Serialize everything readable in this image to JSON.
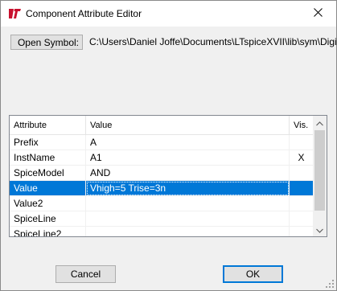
{
  "window": {
    "title": "Component Attribute Editor"
  },
  "toolbar": {
    "open_symbol_label": "Open Symbol:",
    "symbol_path": "C:\\Users\\Daniel Joffe\\Documents\\LTspiceXVII\\lib\\sym\\Digital\\"
  },
  "grid": {
    "headers": {
      "attribute": "Attribute",
      "value": "Value",
      "visible": "Vis."
    },
    "rows": [
      {
        "attribute": "Prefix",
        "value": "A",
        "visible": ""
      },
      {
        "attribute": "InstName",
        "value": "A1",
        "visible": "X"
      },
      {
        "attribute": "SpiceModel",
        "value": "AND",
        "visible": ""
      },
      {
        "attribute": "Value",
        "value": "Vhigh=5 Trise=3n",
        "visible": ""
      },
      {
        "attribute": "Value2",
        "value": "",
        "visible": ""
      },
      {
        "attribute": "SpiceLine",
        "value": "",
        "visible": ""
      },
      {
        "attribute": "SpiceLine2",
        "value": "",
        "visible": ""
      }
    ],
    "selected_row": 3
  },
  "buttons": {
    "cancel_label": "Cancel",
    "ok_label": "OK"
  },
  "icons": {
    "app": "ltspice-logo-icon",
    "close": "close-icon",
    "scroll_up": "chevron-up-icon",
    "scroll_down": "chevron-down-icon"
  },
  "colors": {
    "selection": "#0078d7",
    "app_icon": "#c8102e"
  }
}
